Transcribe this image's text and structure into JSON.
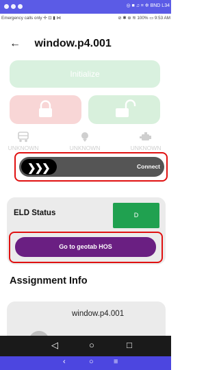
{
  "window": {
    "dots": [
      "close",
      "minimize",
      "maximize"
    ],
    "title_status": "◎ ■ ♫ ⌗  ✲  BND L34"
  },
  "statusbar": {
    "left": "Emergency calls only ✢ ⊡ ▮ ⋈",
    "right": "⊘ ✱ ⊛ ≋ 100% ▭ 9:53 AM"
  },
  "header": {
    "back_glyph": "←",
    "title": "window.p4.001"
  },
  "controls": {
    "initialize_label": "Initialize",
    "status_items": [
      {
        "icon": "truck-icon",
        "label": "UNKNOWN"
      },
      {
        "icon": "signal-icon",
        "label": "UNKNOWN"
      },
      {
        "icon": "engine-icon",
        "label": "UNKNOWN"
      }
    ],
    "slider_chevrons": "❯❯❯",
    "connect_label": "Connect"
  },
  "eld": {
    "title": "ELD Status",
    "status_value": "D",
    "geotab_label": "Go to geotab HOS"
  },
  "assignment": {
    "title": "Assignment Info",
    "vehicle_name": "window.p4.001"
  },
  "nav": {
    "back": "◁",
    "home": "○",
    "recent": "□"
  },
  "host_nav": {
    "back": "‹",
    "home": "○",
    "menu": "≡"
  },
  "colors": {
    "accent_purple": "#6a1f82",
    "eld_green": "#20a150",
    "highlight_red": "#e01010",
    "topbar_blue": "#5b5be6",
    "bottombar_blue": "#4c46e0"
  }
}
